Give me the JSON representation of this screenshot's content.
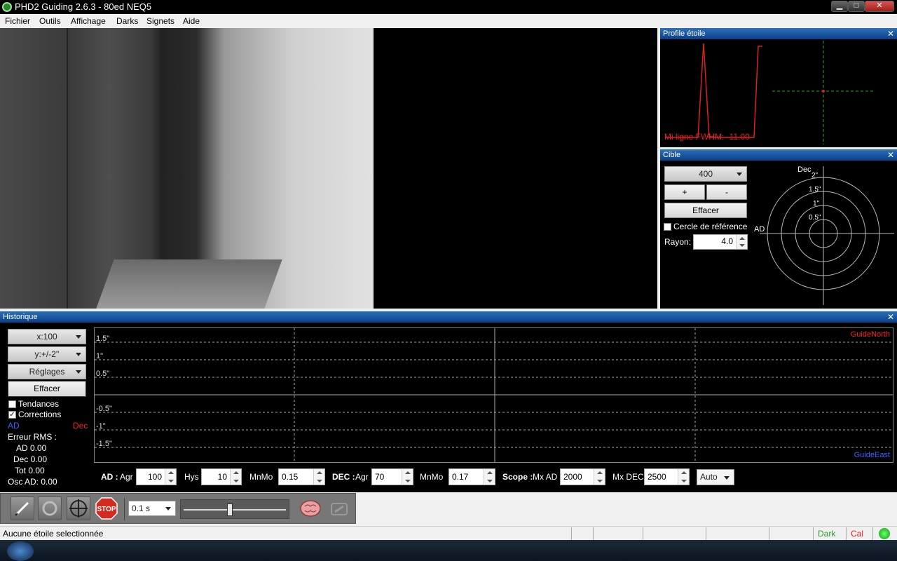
{
  "window": {
    "title": "PHD2 Guiding 2.6.3 - 80ed NEQ5",
    "minimize": "▁",
    "maximize": "□",
    "close": "✕"
  },
  "menu": [
    "Fichier",
    "Outils",
    "Affichage",
    "Darks",
    "Signets",
    "Aide"
  ],
  "profile": {
    "title": "Profile étoile",
    "close": "✕",
    "fwhm_label": "Mi ligne FWHM: -11.00"
  },
  "target": {
    "title": "Cible",
    "close": "✕",
    "scale_value": "400",
    "plus_label": "+",
    "minus_label": "-",
    "clear_label": "Effacer",
    "reference_circle_label": "Cercle de référence",
    "reference_circle_checked": false,
    "radius_label": "Rayon:",
    "radius_value": "4.0",
    "axis_dec": "Dec",
    "axis_ad": "AD",
    "ring_labels": [
      "2\"",
      "1.5\"",
      "1\"",
      "0.5\""
    ]
  },
  "history": {
    "title": "Historique",
    "close": "✕",
    "x_scale": "x:100",
    "y_scale": "y:+/-2''",
    "settings": "Réglages",
    "clear": "Effacer",
    "trends_label": "Tendances",
    "trends_checked": false,
    "corrections_label": "Corrections",
    "corrections_checked": true,
    "legend_ad": "AD",
    "legend_dec": "Dec",
    "rms_label": "Erreur RMS :",
    "rms_ad": "AD 0.00",
    "rms_dec": "Dec 0.00",
    "rms_tot": "Tot 0.00",
    "osc_ad": "Osc AD: 0.00",
    "grid_labels": [
      "1.5\"",
      "1\"",
      "0.5\"",
      "-0.5\"",
      "-1\"",
      "-1.5\""
    ],
    "guide_north": "GuideNorth",
    "guide_east": "GuideEast",
    "colors": {
      "ad": "#4060ff",
      "dec": "#ff2020"
    }
  },
  "params": {
    "ad_label": "AD :",
    "agr_label": "Agr",
    "ad_agr": "100",
    "hys_label": "Hys",
    "ad_hys": "10",
    "mnmo_label": "MnMo",
    "ad_mnmo": "0.15",
    "dec_label": "DEC :",
    "dec_agr_label": "Agr",
    "dec_agr": "70",
    "dec_mnmo_label": "MnMo",
    "dec_mnmo": "0.17",
    "scope_label": "Scope :",
    "mx_ad_label": "Mx AD",
    "mx_ad": "2000",
    "mx_dec_label": "Mx DEC",
    "mx_dec": "2500",
    "mode": "Auto"
  },
  "toolbar": {
    "exposure": "0.1 s",
    "exposure_slider_fraction": 0.45,
    "stop_label": "STOP"
  },
  "status": {
    "message": "Aucune étoile selectionnée",
    "dark": "Dark",
    "cal": "Cal"
  }
}
